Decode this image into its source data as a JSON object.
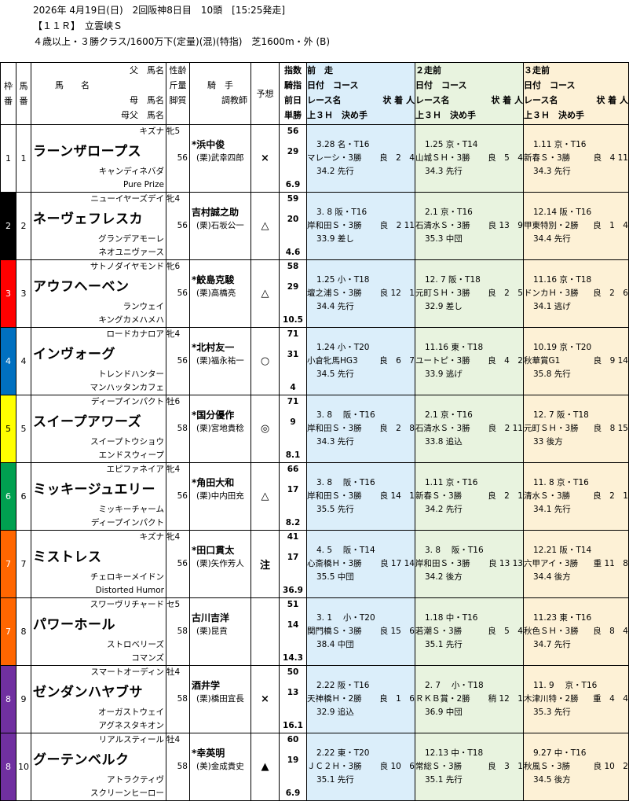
{
  "header": {
    "line1": "2026年 4月19日(日)　2回阪神8日目　10頭　[15:25発走]",
    "line2": "【１１Ｒ】　立雲峡Ｓ",
    "line3": "４歳以上・３勝クラス/1600万下(定量)(混)(特指)　芝1600m・外 (B)"
  },
  "columns": {
    "waku": [
      "枠",
      "番"
    ],
    "uma": [
      "馬",
      "番"
    ],
    "sire": "父　馬名",
    "horse": "馬　　名",
    "dam": "母　馬名",
    "damsire": "母父　馬名",
    "sex": "性齢",
    "weight": "斤量",
    "kyakushitsu": "脚質",
    "jockey": "騎　手",
    "trainer": "調教師",
    "yoso": "予想",
    "shisu": "指数",
    "kishi": "騎指",
    "zenjitsu": "前日",
    "tansho": "単勝",
    "race_heads": [
      "前　走",
      "２走前",
      "３走前"
    ],
    "race_sub1": "日付　コース",
    "race_sub2_left": "レース名",
    "race_sub2_right": "状 着 人",
    "race_sub3": "上３Ｈ　決め手"
  },
  "colors": {
    "waku": [
      "#ffffff",
      "#000000",
      "#ff0000",
      "#0070c0",
      "#ffff00",
      "#00a050",
      "#ff6600",
      "#ff6600",
      "#7030a0",
      "#7030a0"
    ],
    "bg1": "#dbeefa",
    "bg2": "#e8f3df",
    "bg3": "#fdf1d6"
  },
  "horses": [
    {
      "waku": "1",
      "num": "1",
      "sire": "キズナ",
      "name": "ラーンザロープス",
      "dam": "キャンディネバダ",
      "damsire": "Pure Prize",
      "sex": "牝5",
      "weight": "56",
      "jockey": "*浜中俊",
      "trainer": "(栗)武幸四郎",
      "mark": "×",
      "idx": "56",
      "kidx": "29",
      "odds": "6.9",
      "r1": {
        "date": "3.28 名・T16",
        "race": "マレーシ・3勝",
        "res": "良　2　4",
        "last": "34.2 先行"
      },
      "r2": {
        "date": "1.25 京・T14",
        "race": "山城ＳＨ・3勝",
        "res": "良　5　4",
        "last": "34.3 先行"
      },
      "r3": {
        "date": "1.11 京・T16",
        "race": "新春Ｓ・3勝",
        "res": "良　4 11",
        "last": "34.3 先行"
      }
    },
    {
      "waku": "2",
      "num": "2",
      "sire": "ニューイヤーズデイ",
      "name": "ネーヴェフレスカ",
      "dam": "グランデアモーレ",
      "damsire": "ネオユニヴァース",
      "sex": "牝4",
      "weight": "56",
      "jockey": "吉村誠之助",
      "trainer": "(栗)石坂公一",
      "mark": "△",
      "idx": "59",
      "kidx": "20",
      "odds": "4.6",
      "r1": {
        "date": "3. 8 阪・T16",
        "race": "岸和田Ｓ・3勝",
        "res": "良　2 11",
        "last": "33.9 差し"
      },
      "r2": {
        "date": "2.1 京・T16",
        "race": "石清水Ｓ・3勝",
        "res": "良 13　9",
        "last": "35.3 中団"
      },
      "r3": {
        "date": "12.14 阪・T16",
        "race": "甲東特別・2勝",
        "res": "良　1　4",
        "last": "34.4 先行"
      }
    },
    {
      "waku": "3",
      "num": "3",
      "sire": "サトノダイヤモンド",
      "name": "アウフヘーベン",
      "dam": "ランウェイ",
      "damsire": "キングカメハメハ",
      "sex": "牝6",
      "weight": "56",
      "jockey": "*鮫島克駿",
      "trainer": "(栗)高橋亮",
      "mark": "△",
      "idx": "58",
      "kidx": "29",
      "odds": "10.5",
      "r1": {
        "date": "1.25 小・T18",
        "race": "壇之浦Ｓ・3勝",
        "res": "良 12　1",
        "last": "34.4 先行"
      },
      "r2": {
        "date": "12. 7 阪・T18",
        "race": "元町ＳＨ・3勝",
        "res": "良　2　5",
        "last": "32.9 差し"
      },
      "r3": {
        "date": "11.16 京・T18",
        "race": "ドンカＨ・3勝",
        "res": "良　2　6",
        "last": "34.1 逃げ"
      }
    },
    {
      "waku": "4",
      "num": "4",
      "sire": "ロードカナロア",
      "name": "インヴォーグ",
      "dam": "トレンドハンター",
      "damsire": "マンハッタンカフェ",
      "sex": "牝4",
      "weight": "56",
      "jockey": "*北村友一",
      "trainer": "(栗)福永祐一",
      "mark": "○",
      "idx": "71",
      "kidx": "31",
      "odds": "4",
      "r1": {
        "date": "1.24 小・T20",
        "race": "小倉牝馬HG3",
        "res": "良　6　7",
        "last": "34.5 先行"
      },
      "r2": {
        "date": "11.16 東・T18",
        "race": "ユートピ・3勝",
        "res": "良　4　2",
        "last": "33.9 逃げ"
      },
      "r3": {
        "date": "10.19 京・T20",
        "race": "秋華賞G1",
        "res": "良　9 14",
        "last": "35.8 先行"
      }
    },
    {
      "waku": "5",
      "num": "5",
      "sire": "ディープインパクト",
      "name": "スイープアワーズ",
      "dam": "スイープトウショウ",
      "damsire": "エンドスウィープ",
      "sex": "牡6",
      "weight": "58",
      "jockey": "*国分優作",
      "trainer": "(栗)宮地貴稔",
      "mark": "◎",
      "idx": "71",
      "kidx": "9",
      "odds": "8.1",
      "r1": {
        "date": "3. 8　 阪・T16",
        "race": "岸和田Ｓ・3勝",
        "res": "良　2　8",
        "last": "34.3 先行"
      },
      "r2": {
        "date": "2.1 京・T16",
        "race": "石清水Ｓ・3勝",
        "res": "良　2 11",
        "last": "33.8 追込"
      },
      "r3": {
        "date": "12. 7 阪・T18",
        "race": "元町ＳＨ・3勝",
        "res": "良　8 15",
        "last": "33 後方"
      }
    },
    {
      "waku": "6",
      "num": "6",
      "sire": "エピファネイア",
      "name": "ミッキージュエリー",
      "dam": "ミッキーチャーム",
      "damsire": "ディープインパクト",
      "sex": "牝4",
      "weight": "56",
      "jockey": "*角田大和",
      "trainer": "(栗)中内田充",
      "mark": "△",
      "idx": "66",
      "kidx": "17",
      "odds": "8.2",
      "r1": {
        "date": "3. 8　 阪・T16",
        "race": "岸和田Ｓ・3勝",
        "res": "良 14　1",
        "last": "35.5 先行"
      },
      "r2": {
        "date": "1.11 京・T16",
        "race": "新春Ｓ・3勝",
        "res": "良　2　1",
        "last": "34.2 先行"
      },
      "r3": {
        "date": "11. 8 京・T16",
        "race": "清水Ｓ・3勝",
        "res": "良　2　1",
        "last": "34.1 先行"
      }
    },
    {
      "waku": "7",
      "num": "7",
      "sire": "キズナ",
      "name": "ミストレス",
      "dam": "チェロキーメイドン",
      "damsire": "Distorted Humor",
      "sex": "牝4",
      "weight": "56",
      "jockey": "*田口貫太",
      "trainer": "(栗)矢作芳人",
      "mark": "注",
      "idx": "41",
      "kidx": "17",
      "odds": "36.9",
      "r1": {
        "date": "4. 5　 阪・T14",
        "race": "心斎橋Ｈ・3勝",
        "res": "良 17 14",
        "last": "35.5 中団"
      },
      "r2": {
        "date": "3. 8　 阪・T16",
        "race": "岸和田Ｓ・3勝",
        "res": "良 13 13",
        "last": "34.2 後方"
      },
      "r3": {
        "date": "12.21 阪・T14",
        "race": "六甲アイ・3勝",
        "res": "重 11　8",
        "last": "34.4 後方"
      }
    },
    {
      "waku": "7",
      "num": "8",
      "sire": "スワーヴリチャード",
      "name": "パワーホール",
      "dam": "ストロベリーズ",
      "damsire": "コマンズ",
      "sex": "セ5",
      "weight": "58",
      "jockey": "古川吉洋",
      "trainer": "(栗)昆貢",
      "mark": "",
      "idx": "51",
      "kidx": "14",
      "odds": "14.3",
      "r1": {
        "date": "3. 1　 小・T20",
        "race": "関門橋Ｓ・3勝",
        "res": "良 15　6",
        "last": "38.4 中団"
      },
      "r2": {
        "date": "1.18 中・T16",
        "race": "若潮Ｓ・3勝",
        "res": "良　5　4",
        "last": "35.1 先行"
      },
      "r3": {
        "date": "11.23 東・T16",
        "race": "秋色ＳＨ・3勝",
        "res": "良　8　4",
        "last": "34.7 先行"
      }
    },
    {
      "waku": "8",
      "num": "9",
      "sire": "スマートオーディン",
      "name": "ゼンダンハヤブサ",
      "dam": "オーガストウェイ",
      "damsire": "アグネスタキオン",
      "sex": "牡4",
      "weight": "58",
      "jockey": "酒井学",
      "trainer": "(栗)橋田宜長",
      "mark": "×",
      "idx": "50",
      "kidx": "13",
      "odds": "16.1",
      "r1": {
        "date": "2.22 阪・T16",
        "race": "天神橋Ｈ・2勝",
        "res": "良　1　6",
        "last": "32.9 追込"
      },
      "r2": {
        "date": "2. 7　 小・T18",
        "race": "ＲＫＢ賞・2勝",
        "res": "稍 12　1",
        "last": "36.9 中団"
      },
      "r3": {
        "date": "11. 9　 京・T16",
        "race": "木津川特・2勝",
        "res": "重　4　4",
        "last": "35.3 先行"
      }
    },
    {
      "waku": "8",
      "num": "10",
      "sire": "リアルスティール",
      "name": "グーテンベルク",
      "dam": "アトラクティヴ",
      "damsire": "スクリーンヒーロー",
      "sex": "牡4",
      "weight": "58",
      "jockey": "*幸英明",
      "trainer": "(美)金成貴史",
      "mark": "▲",
      "idx": "60",
      "kidx": "19",
      "odds": "6.9",
      "r1": {
        "date": "2.22 東・T20",
        "race": "ＪＣ２Ｈ・3勝",
        "res": "良 10　6",
        "last": "35.1 先行"
      },
      "r2": {
        "date": "12.13 中・T18",
        "race": "常総Ｓ・3勝",
        "res": "良　3　1",
        "last": "35.1 先行"
      },
      "r3": {
        "date": "9.27 中・T16",
        "race": "秋風Ｓ・3勝",
        "res": "良 10　2",
        "last": "34.5 後方"
      }
    }
  ]
}
